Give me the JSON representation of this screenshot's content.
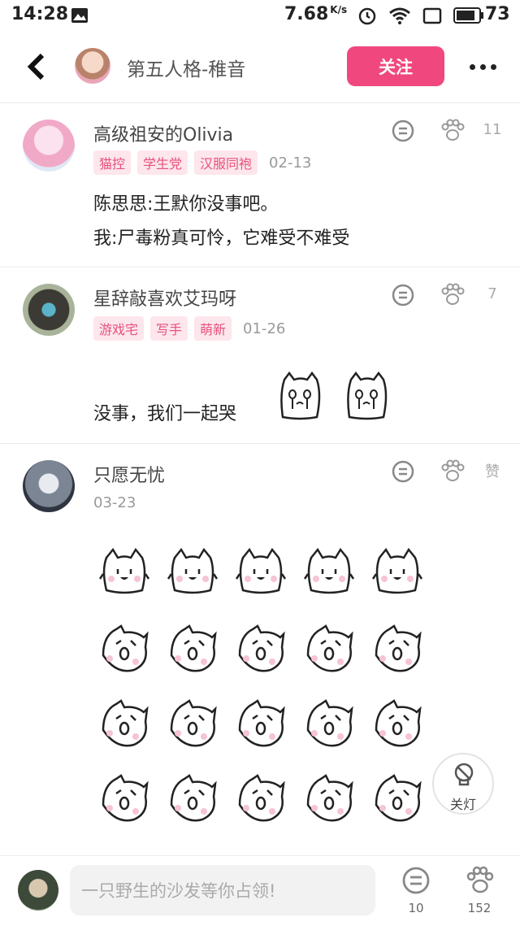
{
  "status_bar": {
    "time": "14:28",
    "speed": "7.68",
    "speed_unit": "K/s",
    "battery": "73"
  },
  "header": {
    "title": "第五人格-稚音",
    "follow_label": "关注"
  },
  "comments": [
    {
      "username": "高级祖安的Olivia",
      "tags": [
        "猫控",
        "学生党",
        "汉服同袍"
      ],
      "date": "02-13",
      "likes": "11",
      "lines": [
        "陈思思:王默你没事吧。",
        "我:尸毒粉真可怜，它难受不难受"
      ]
    },
    {
      "username": "星辞敲喜欢艾玛呀",
      "tags": [
        "游戏宅",
        "写手",
        "萌新"
      ],
      "date": "01-26",
      "likes": "7",
      "lines": [
        "没事，我们一起哭"
      ]
    },
    {
      "username": "只愿无忧",
      "tags": [],
      "date": "03-23",
      "likes": "赞",
      "lines": []
    }
  ],
  "lamp_label": "关灯",
  "bottom_bar": {
    "placeholder": "一只野生的沙发等你占领!",
    "reply_count": "10",
    "like_count": "152"
  },
  "colors": {
    "accent": "#f0487e",
    "tag_bg": "#fde6ec",
    "tag_text": "#e8507d"
  }
}
